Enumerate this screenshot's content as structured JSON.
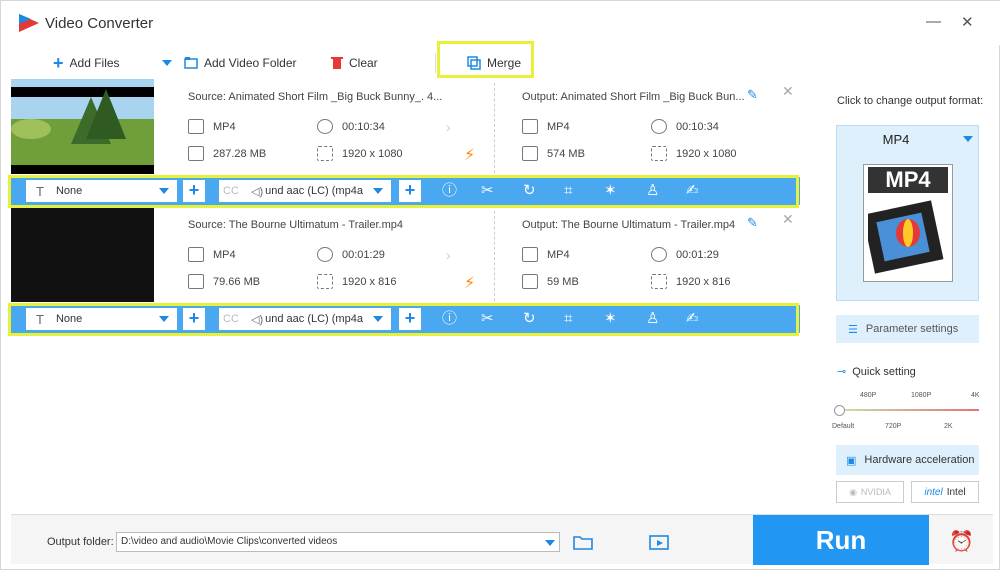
{
  "app": {
    "title": "Video Converter",
    "minimize": "—",
    "close": "✕"
  },
  "toolbar": {
    "add_files": "Add Files",
    "add_folder": "Add Video Folder",
    "clear": "Clear",
    "merge": "Merge"
  },
  "items": [
    {
      "source": "Source: Animated Short Film _Big Buck Bunny_. 4...",
      "output": "Output: Animated Short Film _Big Buck Bun...",
      "src_format": "MP4",
      "src_duration": "00:10:34",
      "src_size": "287.28 MB",
      "src_res": "1920 x 1080",
      "out_format": "MP4",
      "out_duration": "00:10:34",
      "out_size": "574 MB",
      "out_res": "1920 x 1080",
      "subtitle": "None",
      "audio": "und aac (LC) (mp4a"
    },
    {
      "source": "Source: The Bourne Ultimatum - Trailer.mp4",
      "output": "Output: The Bourne Ultimatum - Trailer.mp4",
      "src_format": "MP4",
      "src_duration": "00:01:29",
      "src_size": "79.66 MB",
      "src_res": "1920 x 816",
      "out_format": "MP4",
      "out_duration": "00:01:29",
      "out_size": "59 MB",
      "out_res": "1920 x 816",
      "subtitle": "None",
      "audio": "und aac (LC) (mp4a"
    }
  ],
  "right_panel": {
    "label": "Click to change output format:",
    "format": "MP4",
    "format_image_text": "MP4",
    "parameter_settings": "Parameter settings",
    "quick_setting": "Quick setting",
    "slider_top": [
      "480P",
      "1080P",
      "4K"
    ],
    "slider_bottom": [
      "Default",
      "720P",
      "2K"
    ],
    "hardware_acceleration": "Hardware acceleration",
    "nvidia": "NVIDIA",
    "intel": "Intel"
  },
  "bottom": {
    "output_folder_label": "Output folder:",
    "output_folder_path": "D:\\video and audio\\Movie Clips\\converted videos",
    "run": "Run"
  },
  "colors": {
    "accent": "#2196f3",
    "bar": "#4aa8f0",
    "highlight": "#e8f03a",
    "convert_bolt": "#ff8a00"
  }
}
